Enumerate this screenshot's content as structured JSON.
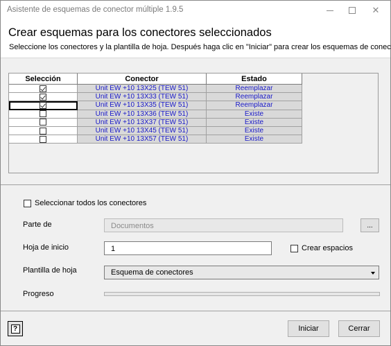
{
  "window": {
    "title": "Asistente de esquemas de conector múltiple 1.9.5"
  },
  "header": {
    "title": "Crear esquemas para los conectores seleccionados",
    "subtitle": "Seleccione los conectores y la plantilla de hoja. Después haga clic en \"Iniciar\" para crear los esquemas de conectores."
  },
  "grid": {
    "columns": [
      "Selección",
      "Conector",
      "Estado"
    ],
    "rows": [
      {
        "selected": true,
        "connector": "Unit EW +10 13X25 (TEW 51)",
        "status": "Reemplazar"
      },
      {
        "selected": true,
        "connector": "Unit EW +10 13X33 (TEW 51)",
        "status": "Reemplazar"
      },
      {
        "selected": true,
        "connector": "Unit EW +10 13X35 (TEW 51)",
        "status": "Reemplazar"
      },
      {
        "selected": false,
        "connector": "Unit EW +10 13X36 (TEW 51)",
        "status": "Existe"
      },
      {
        "selected": false,
        "connector": "Unit EW +10 13X37 (TEW 51)",
        "status": "Existe"
      },
      {
        "selected": false,
        "connector": "Unit EW +10 13X45 (TEW 51)",
        "status": "Existe"
      },
      {
        "selected": false,
        "connector": "Unit EW +10 13X57 (TEW 51)",
        "status": "Existe"
      }
    ],
    "current_row": 2
  },
  "form": {
    "select_all_label": "Seleccionar todos los conectores",
    "select_all_checked": false,
    "part_of_label": "Parte de",
    "part_of_value": "Documentos",
    "browse_label": "...",
    "start_sheet_label": "Hoja de inicio",
    "start_sheet_value": "1",
    "create_spaces_label": "Crear espacios",
    "create_spaces_checked": false,
    "template_label": "Plantilla de hoja",
    "template_value": "Esquema de conectores",
    "progress_label": "Progreso",
    "progress_value": 0
  },
  "footer": {
    "help_icon": "?",
    "start_label": "Iniciar",
    "close_label": "Cerrar"
  },
  "icons": {
    "minimize": "minimize-icon",
    "maximize": "maximize-icon",
    "close": "close-icon",
    "help": "help-icon",
    "dropdown": "chevron-down-icon"
  }
}
